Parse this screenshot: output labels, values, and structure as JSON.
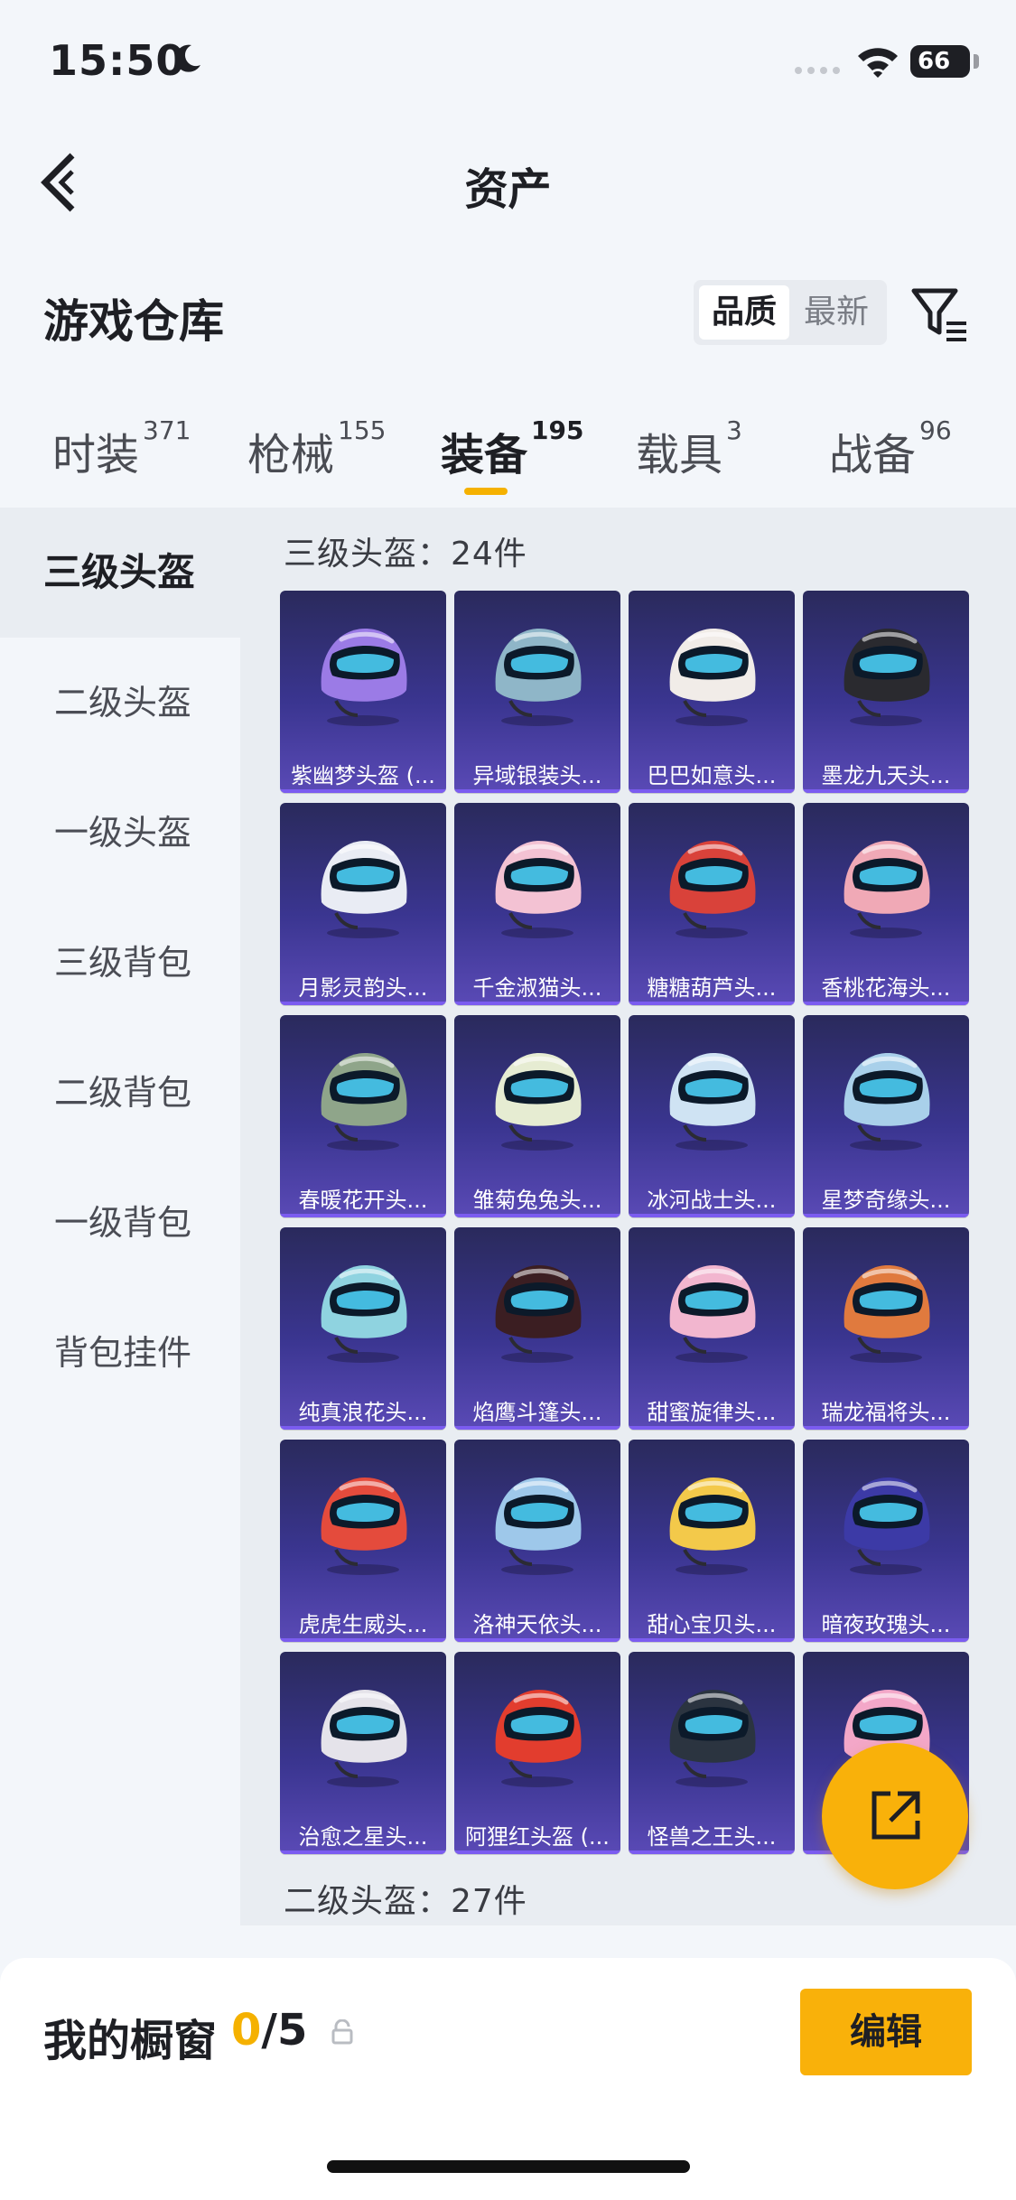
{
  "status_bar": {
    "time": "15:50",
    "battery": "66"
  },
  "nav": {
    "title": "资产"
  },
  "header": {
    "title": "游戏仓库",
    "sort_options": [
      "品质",
      "最新"
    ]
  },
  "tabs": [
    {
      "label": "时装",
      "count": "371"
    },
    {
      "label": "枪械",
      "count": "155"
    },
    {
      "label": "装备",
      "count": "195"
    },
    {
      "label": "载具",
      "count": "3"
    },
    {
      "label": "战备",
      "count": "96"
    }
  ],
  "sidebar": {
    "items": [
      "三级头盔",
      "二级头盔",
      "一级头盔",
      "三级背包",
      "二级背包",
      "一级背包",
      "背包挂件"
    ]
  },
  "sections": [
    {
      "title": "三级头盔：24件"
    },
    {
      "title": "二级头盔：27件"
    }
  ],
  "items": [
    {
      "name": "紫幽梦头盔 (...",
      "color": "#9b7be6"
    },
    {
      "name": "异域银装头...",
      "color": "#8fb6c8"
    },
    {
      "name": "巴巴如意头...",
      "color": "#f1ece8"
    },
    {
      "name": "墨龙九天头...",
      "color": "#2a2a2f"
    },
    {
      "name": "月影灵韵头...",
      "color": "#e9ecf4"
    },
    {
      "name": "千金淑猫头...",
      "color": "#f3c2d3"
    },
    {
      "name": "糖糖葫芦头...",
      "color": "#d9423a"
    },
    {
      "name": "香桃花海头...",
      "color": "#f0a9b6"
    },
    {
      "name": "春暖花开头...",
      "color": "#8fa58a"
    },
    {
      "name": "雏菊兔兔头...",
      "color": "#e6ecd2"
    },
    {
      "name": "冰河战士头...",
      "color": "#cfe3f3"
    },
    {
      "name": "星梦奇缘头...",
      "color": "#a9d0ea"
    },
    {
      "name": "纯真浪花头...",
      "color": "#8fd3e0"
    },
    {
      "name": "焰鹰斗篷头...",
      "color": "#3b1e22"
    },
    {
      "name": "甜蜜旋律头...",
      "color": "#f2b6cf"
    },
    {
      "name": "瑞龙福将头...",
      "color": "#e07a3e"
    },
    {
      "name": "虎虎生威头...",
      "color": "#e44b3c"
    },
    {
      "name": "洛神天依头...",
      "color": "#9ec8ea"
    },
    {
      "name": "甜心宝贝头...",
      "color": "#f3c94a"
    },
    {
      "name": "暗夜玫瑰头...",
      "color": "#3c3aa6"
    },
    {
      "name": "治愈之星头...",
      "color": "#e5e3ea"
    },
    {
      "name": "阿狸红头盔 (...",
      "color": "#e23d2e"
    },
    {
      "name": "怪兽之王头...",
      "color": "#2b3440"
    },
    {
      "name": "",
      "color": "#f3a7c8"
    }
  ],
  "showcase": {
    "label": "我的橱窗",
    "current": "0",
    "max": "/5"
  },
  "edit_label": "编辑"
}
